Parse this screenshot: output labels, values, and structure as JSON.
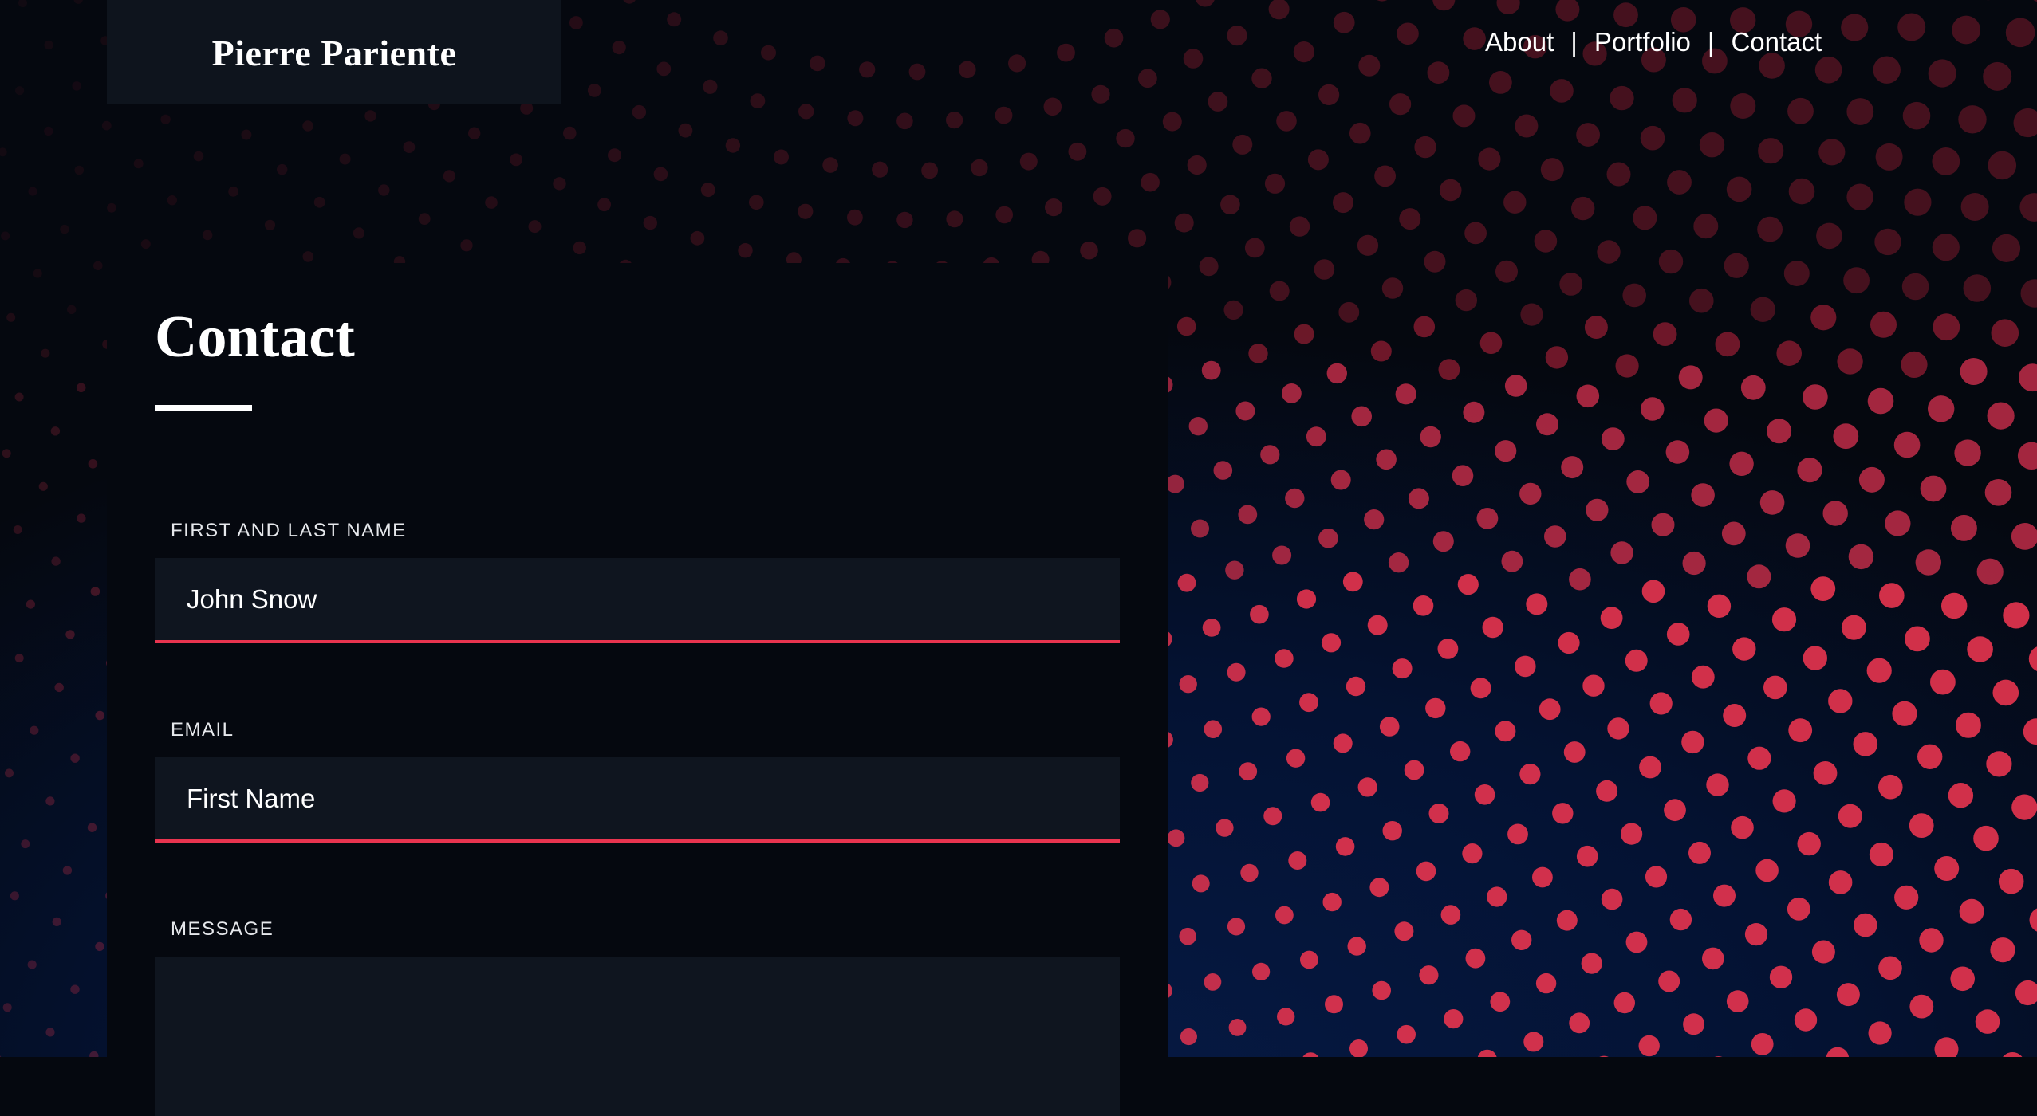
{
  "header": {
    "logo": "Pierre Pariente",
    "nav": {
      "items": [
        "About",
        "Portfolio",
        "Contact"
      ],
      "separator": "|"
    }
  },
  "main": {
    "title": "Contact",
    "form": {
      "name": {
        "label": "FIRST AND LAST NAME",
        "value": "John Snow"
      },
      "email": {
        "label": "EMAIL",
        "placeholder": "First Name"
      },
      "message": {
        "label": "MESSAGE",
        "value": ""
      }
    }
  },
  "colors": {
    "accent": "#e8344f",
    "background": "#05080f",
    "field": "#0f151f",
    "header_box": "#0e141d",
    "background_glow": "#061a45"
  },
  "decor": {
    "background": "red-halftone-dot-pattern"
  }
}
